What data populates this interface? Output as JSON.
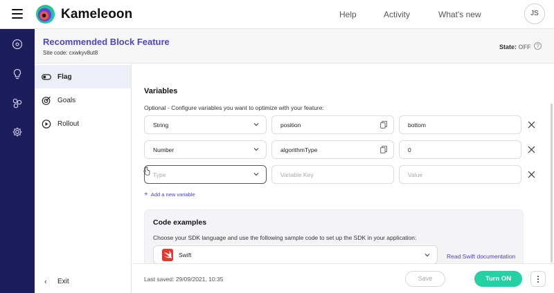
{
  "app": {
    "brand": "Kameleoon"
  },
  "topnav": {
    "help": "Help",
    "activity": "Activity",
    "whats_new": "What's new",
    "avatar_initials": "JS"
  },
  "header": {
    "title": "Recommended Block Feature",
    "site_code": "Site code: cxwkyv8ut8",
    "state_label": "State:",
    "state_value": "OFF",
    "help_glyph": "?"
  },
  "sidemenu": {
    "items": [
      {
        "label": "Flag",
        "icon": "toggle-icon"
      },
      {
        "label": "Goals",
        "icon": "target-icon"
      },
      {
        "label": "Rollout",
        "icon": "play-circle-icon"
      }
    ],
    "exit": "Exit"
  },
  "variables": {
    "title": "Variables",
    "description": "Optional - Configure variables you want to optimize with your feature:",
    "rows": [
      {
        "type": "String",
        "key": "position",
        "value": "bottom"
      },
      {
        "type": "Number",
        "key": "algorithmType",
        "value": "0"
      }
    ],
    "new_row": {
      "type_placeholder": "Type",
      "key_placeholder": "Variable Key",
      "value_placeholder": "Value"
    },
    "add_link": "Add a new variable"
  },
  "code_examples": {
    "title": "Code examples",
    "description": "Choose your SDK language and use the following sample code to set up the SDK in your application:",
    "selected_sdk": "Swift",
    "doc_link": "Read Swift documentation"
  },
  "footer": {
    "last_saved": "Last saved: 29/09/2021, 10:35",
    "save": "Save",
    "turn_on": "Turn ON"
  },
  "colors": {
    "accent": "#4b45c8",
    "rail": "#1d1d5c",
    "turn_on": "#25d0a2",
    "swift": "#e8382d"
  }
}
